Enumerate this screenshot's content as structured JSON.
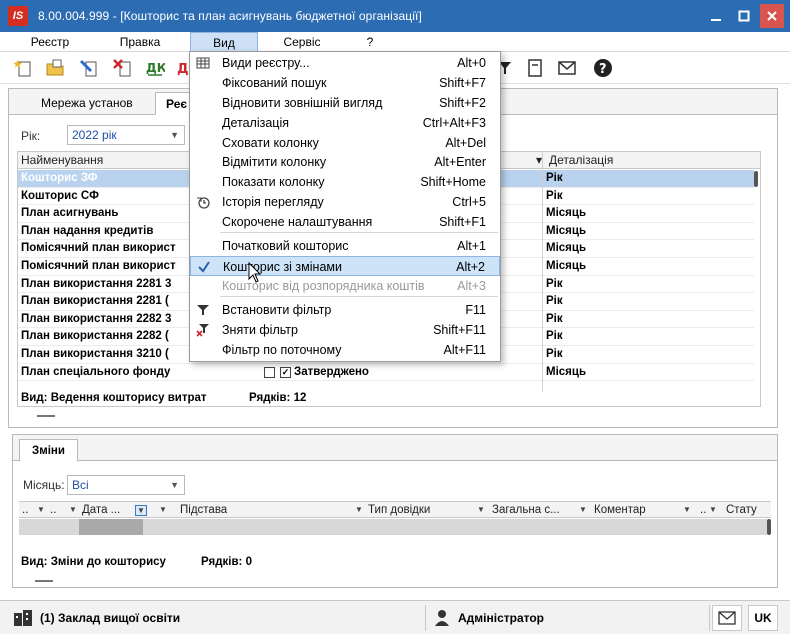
{
  "window": {
    "title": "8.00.004.999 - [Кошторис та план асигнувань бюджетної організації]",
    "logo": "IS"
  },
  "menubar": [
    "Реєстр",
    "Правка",
    "Вид",
    "Сервіс",
    "?"
  ],
  "tabs": [
    "Мережа установ",
    "Реє"
  ],
  "filter": {
    "year_label": "Рік:",
    "year_value": "2022 рік"
  },
  "grid": {
    "headers": [
      "Найменування",
      "Деталізація"
    ],
    "rows": [
      {
        "name": "Кошторис ЗФ",
        "detail": "Рік",
        "selected": true
      },
      {
        "name": "Кошторис СФ",
        "detail": "Рік"
      },
      {
        "name": "План асигнувань",
        "detail": "Місяць"
      },
      {
        "name": "План надання кредитів",
        "detail": "Місяць"
      },
      {
        "name": "Помісячний план використ",
        "detail": "Місяць"
      },
      {
        "name": "Помісячний план використ",
        "detail": "Місяць"
      },
      {
        "name": "План використання 2281 3",
        "detail": "Рік"
      },
      {
        "name": "План використання 2281 (",
        "detail": "Рік"
      },
      {
        "name": "План використання 2282 3",
        "detail": "Рік"
      },
      {
        "name": "План використання 2282 (",
        "detail": "Рік"
      },
      {
        "name": "План використання 3210 (",
        "detail": "Рік"
      },
      {
        "name": "План спеціального фонду",
        "detail": "Місяць",
        "status": "Затверджено"
      }
    ],
    "footer_view": "Вид: Ведення кошторису витрат",
    "footer_count": "Рядків: 12"
  },
  "changes": {
    "tab": "Зміни",
    "month_label": "Місяць:",
    "month_value": "Всі",
    "headers": [
      "..",
      "..",
      "Дата ...",
      "Підстава",
      "Тип довідки",
      "Загальна с...",
      "Коментар",
      "..",
      "Стату"
    ],
    "footer_view": "Вид: Зміни до кошторису",
    "footer_count": "Рядків: 0"
  },
  "statusbar": {
    "org": "(1) Заклад вищої освіти",
    "user": "Адміністратор",
    "lang": "UK"
  },
  "view_menu": {
    "items": [
      {
        "label": "Види реєстру...",
        "shortcut": "Alt+0",
        "icon": "grid-icon"
      },
      {
        "label": "Фіксований пошук",
        "shortcut": "Shift+F7"
      },
      {
        "label": "Відновити зовнішній вигляд",
        "shortcut": "Shift+F2"
      },
      {
        "label": "Деталізація",
        "shortcut": "Ctrl+Alt+F3"
      },
      {
        "label": "Сховати колонку",
        "shortcut": "Alt+Del"
      },
      {
        "label": "Відмітити колонку",
        "shortcut": "Alt+Enter"
      },
      {
        "label": "Показати колонку",
        "shortcut": "Shift+Home"
      },
      {
        "label": "Історія перегляду",
        "shortcut": "Ctrl+5",
        "icon": "history-icon"
      },
      {
        "label": "Скорочене налаштування",
        "shortcut": "Shift+F1"
      },
      {
        "label": "Початковий кошторис",
        "shortcut": "Alt+1"
      },
      {
        "label": "Кошторис зі змінами",
        "shortcut": "Alt+2",
        "checked": true
      },
      {
        "label": "Кошторис від розпорядника коштів",
        "shortcut": "Alt+3",
        "disabled": true
      },
      {
        "label": "Встановити фільтр",
        "shortcut": "F11",
        "icon": "filter-icon"
      },
      {
        "label": "Зняти фільтр",
        "shortcut": "Shift+F11",
        "icon": "remove-filter-icon"
      },
      {
        "label": "Фільтр по поточному",
        "shortcut": "Alt+F11"
      }
    ]
  },
  "colors": {
    "titlebar": "#2b6cb3",
    "selection": "#b9d3ef",
    "menu_highlight": "#cde3f7",
    "close": "#d9534f",
    "accent_blue": "#1f4fa8"
  }
}
